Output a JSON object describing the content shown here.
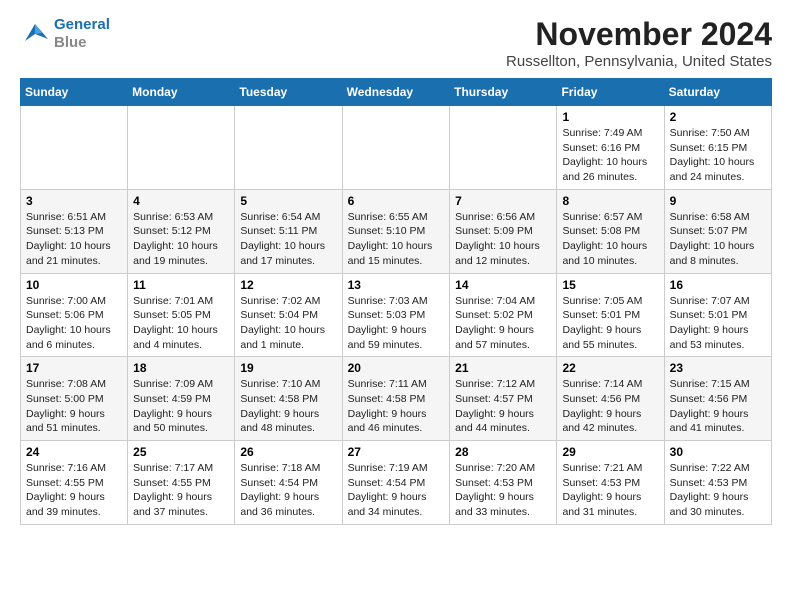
{
  "logo": {
    "line1": "General",
    "line2": "Blue"
  },
  "title": "November 2024",
  "subtitle": "Russellton, Pennsylvania, United States",
  "weekdays": [
    "Sunday",
    "Monday",
    "Tuesday",
    "Wednesday",
    "Thursday",
    "Friday",
    "Saturday"
  ],
  "weeks": [
    [
      {
        "day": "",
        "info": ""
      },
      {
        "day": "",
        "info": ""
      },
      {
        "day": "",
        "info": ""
      },
      {
        "day": "",
        "info": ""
      },
      {
        "day": "",
        "info": ""
      },
      {
        "day": "1",
        "info": "Sunrise: 7:49 AM\nSunset: 6:16 PM\nDaylight: 10 hours and 26 minutes."
      },
      {
        "day": "2",
        "info": "Sunrise: 7:50 AM\nSunset: 6:15 PM\nDaylight: 10 hours and 24 minutes."
      }
    ],
    [
      {
        "day": "3",
        "info": "Sunrise: 6:51 AM\nSunset: 5:13 PM\nDaylight: 10 hours and 21 minutes."
      },
      {
        "day": "4",
        "info": "Sunrise: 6:53 AM\nSunset: 5:12 PM\nDaylight: 10 hours and 19 minutes."
      },
      {
        "day": "5",
        "info": "Sunrise: 6:54 AM\nSunset: 5:11 PM\nDaylight: 10 hours and 17 minutes."
      },
      {
        "day": "6",
        "info": "Sunrise: 6:55 AM\nSunset: 5:10 PM\nDaylight: 10 hours and 15 minutes."
      },
      {
        "day": "7",
        "info": "Sunrise: 6:56 AM\nSunset: 5:09 PM\nDaylight: 10 hours and 12 minutes."
      },
      {
        "day": "8",
        "info": "Sunrise: 6:57 AM\nSunset: 5:08 PM\nDaylight: 10 hours and 10 minutes."
      },
      {
        "day": "9",
        "info": "Sunrise: 6:58 AM\nSunset: 5:07 PM\nDaylight: 10 hours and 8 minutes."
      }
    ],
    [
      {
        "day": "10",
        "info": "Sunrise: 7:00 AM\nSunset: 5:06 PM\nDaylight: 10 hours and 6 minutes."
      },
      {
        "day": "11",
        "info": "Sunrise: 7:01 AM\nSunset: 5:05 PM\nDaylight: 10 hours and 4 minutes."
      },
      {
        "day": "12",
        "info": "Sunrise: 7:02 AM\nSunset: 5:04 PM\nDaylight: 10 hours and 1 minute."
      },
      {
        "day": "13",
        "info": "Sunrise: 7:03 AM\nSunset: 5:03 PM\nDaylight: 9 hours and 59 minutes."
      },
      {
        "day": "14",
        "info": "Sunrise: 7:04 AM\nSunset: 5:02 PM\nDaylight: 9 hours and 57 minutes."
      },
      {
        "day": "15",
        "info": "Sunrise: 7:05 AM\nSunset: 5:01 PM\nDaylight: 9 hours and 55 minutes."
      },
      {
        "day": "16",
        "info": "Sunrise: 7:07 AM\nSunset: 5:01 PM\nDaylight: 9 hours and 53 minutes."
      }
    ],
    [
      {
        "day": "17",
        "info": "Sunrise: 7:08 AM\nSunset: 5:00 PM\nDaylight: 9 hours and 51 minutes."
      },
      {
        "day": "18",
        "info": "Sunrise: 7:09 AM\nSunset: 4:59 PM\nDaylight: 9 hours and 50 minutes."
      },
      {
        "day": "19",
        "info": "Sunrise: 7:10 AM\nSunset: 4:58 PM\nDaylight: 9 hours and 48 minutes."
      },
      {
        "day": "20",
        "info": "Sunrise: 7:11 AM\nSunset: 4:58 PM\nDaylight: 9 hours and 46 minutes."
      },
      {
        "day": "21",
        "info": "Sunrise: 7:12 AM\nSunset: 4:57 PM\nDaylight: 9 hours and 44 minutes."
      },
      {
        "day": "22",
        "info": "Sunrise: 7:14 AM\nSunset: 4:56 PM\nDaylight: 9 hours and 42 minutes."
      },
      {
        "day": "23",
        "info": "Sunrise: 7:15 AM\nSunset: 4:56 PM\nDaylight: 9 hours and 41 minutes."
      }
    ],
    [
      {
        "day": "24",
        "info": "Sunrise: 7:16 AM\nSunset: 4:55 PM\nDaylight: 9 hours and 39 minutes."
      },
      {
        "day": "25",
        "info": "Sunrise: 7:17 AM\nSunset: 4:55 PM\nDaylight: 9 hours and 37 minutes."
      },
      {
        "day": "26",
        "info": "Sunrise: 7:18 AM\nSunset: 4:54 PM\nDaylight: 9 hours and 36 minutes."
      },
      {
        "day": "27",
        "info": "Sunrise: 7:19 AM\nSunset: 4:54 PM\nDaylight: 9 hours and 34 minutes."
      },
      {
        "day": "28",
        "info": "Sunrise: 7:20 AM\nSunset: 4:53 PM\nDaylight: 9 hours and 33 minutes."
      },
      {
        "day": "29",
        "info": "Sunrise: 7:21 AM\nSunset: 4:53 PM\nDaylight: 9 hours and 31 minutes."
      },
      {
        "day": "30",
        "info": "Sunrise: 7:22 AM\nSunset: 4:53 PM\nDaylight: 9 hours and 30 minutes."
      }
    ]
  ]
}
